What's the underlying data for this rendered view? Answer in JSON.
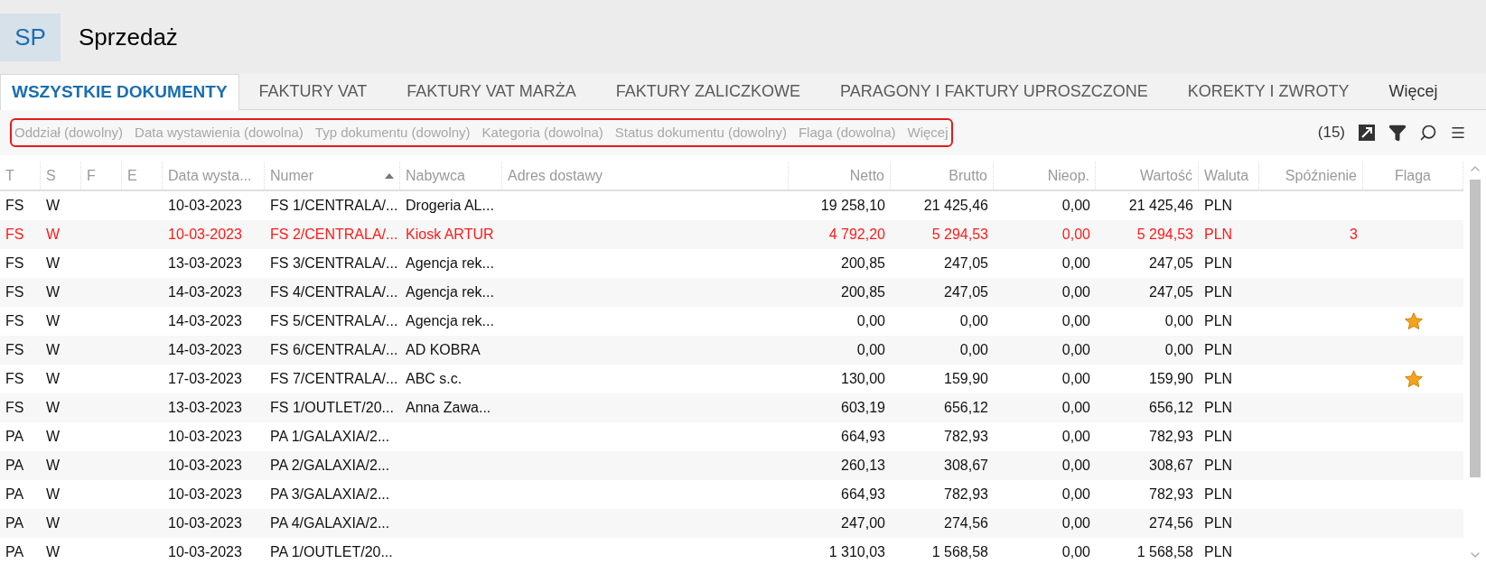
{
  "app": {
    "badge": "SP",
    "title": "Sprzedaż"
  },
  "tabs": [
    {
      "label": "WSZYSTKIE DOKUMENTY",
      "selected": true
    },
    {
      "label": "FAKTURY VAT",
      "selected": false
    },
    {
      "label": "FAKTURY VAT MARŻA",
      "selected": false
    },
    {
      "label": "FAKTURY ZALICZKOWE",
      "selected": false
    },
    {
      "label": "PARAGONY I FAKTURY UPROSZCZONE",
      "selected": false
    },
    {
      "label": "KOREKTY I ZWROTY",
      "selected": false
    },
    {
      "label": "Więcej",
      "selected": false
    }
  ],
  "filters": [
    "Oddział (dowolny)",
    "Data wystawienia (dowolna)",
    "Typ dokumentu (dowolny)",
    "Kategoria (dowolna)",
    "Status dokumentu (dowolny)",
    "Flaga (dowolna)",
    "Więcej"
  ],
  "count": "(15)",
  "table": {
    "columns": [
      {
        "label": "T",
        "sorted": false
      },
      {
        "label": "S",
        "sorted": false
      },
      {
        "label": "F",
        "sorted": false
      },
      {
        "label": "E",
        "sorted": false
      },
      {
        "label": "Data wysta...",
        "sorted": false
      },
      {
        "label": "Numer",
        "sorted": true
      },
      {
        "label": "Nabywca",
        "sorted": false
      },
      {
        "label": "Adres dostawy",
        "sorted": false
      },
      {
        "label": "Netto",
        "sorted": false
      },
      {
        "label": "Brutto",
        "sorted": false
      },
      {
        "label": "Nieop.",
        "sorted": false
      },
      {
        "label": "Wartość",
        "sorted": false
      },
      {
        "label": "Waluta",
        "sorted": false
      },
      {
        "label": "Spóźnienie",
        "sorted": false
      },
      {
        "label": "Flaga",
        "sorted": false
      }
    ],
    "rows": [
      {
        "t": "FS",
        "s": "W",
        "date": "10-03-2023",
        "number": "FS 1/CENTRALA/...",
        "buyer": "Drogeria AL...",
        "netto": "19 258,10",
        "brutto": "21 425,46",
        "unpaid": "0,00",
        "value": "21 425,46",
        "currency": "PLN",
        "overdue": false,
        "flagged": false
      },
      {
        "t": "FS",
        "s": "W",
        "date": "10-03-2023",
        "number": "FS 2/CENTRALA/...",
        "buyer": "Kiosk ARTUR",
        "netto": "4 792,20",
        "brutto": "5 294,53",
        "unpaid": "0,00",
        "value": "5 294,53",
        "currency": "PLN",
        "delay": "3",
        "overdue": true,
        "flagged": false
      },
      {
        "t": "FS",
        "s": "W",
        "date": "13-03-2023",
        "number": "FS 3/CENTRALA/...",
        "buyer": "Agencja rek...",
        "netto": "200,85",
        "brutto": "247,05",
        "unpaid": "0,00",
        "value": "247,05",
        "currency": "PLN",
        "overdue": false,
        "flagged": false
      },
      {
        "t": "FS",
        "s": "W",
        "date": "14-03-2023",
        "number": "FS 4/CENTRALA/...",
        "buyer": "Agencja rek...",
        "netto": "200,85",
        "brutto": "247,05",
        "unpaid": "0,00",
        "value": "247,05",
        "currency": "PLN",
        "overdue": false,
        "flagged": false
      },
      {
        "t": "FS",
        "s": "W",
        "date": "14-03-2023",
        "number": "FS 5/CENTRALA/...",
        "buyer": "Agencja rek...",
        "netto": "0,00",
        "brutto": "0,00",
        "unpaid": "0,00",
        "value": "0,00",
        "currency": "PLN",
        "overdue": false,
        "flagged": true
      },
      {
        "t": "FS",
        "s": "W",
        "date": "14-03-2023",
        "number": "FS 6/CENTRALA/...",
        "buyer": "AD KOBRA",
        "netto": "0,00",
        "brutto": "0,00",
        "unpaid": "0,00",
        "value": "0,00",
        "currency": "PLN",
        "overdue": false,
        "flagged": false
      },
      {
        "t": "FS",
        "s": "W",
        "date": "17-03-2023",
        "number": "FS 7/CENTRALA/...",
        "buyer": "ABC s.c.",
        "netto": "130,00",
        "brutto": "159,90",
        "unpaid": "0,00",
        "value": "159,90",
        "currency": "PLN",
        "overdue": false,
        "flagged": true
      },
      {
        "t": "FS",
        "s": "W",
        "date": "13-03-2023",
        "number": "FS 1/OUTLET/20...",
        "buyer": "Anna Zawa...",
        "netto": "603,19",
        "brutto": "656,12",
        "unpaid": "0,00",
        "value": "656,12",
        "currency": "PLN",
        "overdue": false,
        "flagged": false
      },
      {
        "t": "PA",
        "s": "W",
        "date": "10-03-2023",
        "number": "PA 1/GALAXIA/2...",
        "netto": "664,93",
        "brutto": "782,93",
        "unpaid": "0,00",
        "value": "782,93",
        "currency": "PLN",
        "overdue": false,
        "flagged": false
      },
      {
        "t": "PA",
        "s": "W",
        "date": "10-03-2023",
        "number": "PA 2/GALAXIA/2...",
        "netto": "260,13",
        "brutto": "308,67",
        "unpaid": "0,00",
        "value": "308,67",
        "currency": "PLN",
        "overdue": false,
        "flagged": false
      },
      {
        "t": "PA",
        "s": "W",
        "date": "10-03-2023",
        "number": "PA 3/GALAXIA/2...",
        "netto": "664,93",
        "brutto": "782,93",
        "unpaid": "0,00",
        "value": "782,93",
        "currency": "PLN",
        "overdue": false,
        "flagged": false
      },
      {
        "t": "PA",
        "s": "W",
        "date": "10-03-2023",
        "number": "PA 4/GALAXIA/2...",
        "netto": "247,00",
        "brutto": "274,56",
        "unpaid": "0,00",
        "value": "274,56",
        "currency": "PLN",
        "overdue": false,
        "flagged": false
      },
      {
        "t": "PA",
        "s": "W",
        "date": "10-03-2023",
        "number": "PA 1/OUTLET/20...",
        "netto": "1 310,03",
        "brutto": "1 568,58",
        "unpaid": "0,00",
        "value": "1 568,58",
        "currency": "PLN",
        "overdue": false,
        "flagged": false
      }
    ]
  }
}
